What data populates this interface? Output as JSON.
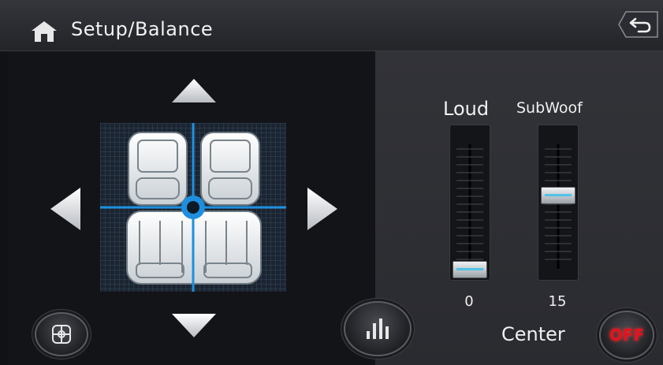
{
  "header": {
    "title": "Setup/Balance",
    "home_icon": "home-icon",
    "back_icon": "back-arrow-icon"
  },
  "balance": {
    "up_icon": "arrow-up-icon",
    "down_icon": "arrow-down-icon",
    "left_icon": "arrow-left-icon",
    "right_icon": "arrow-right-icon",
    "seat_map_icon": "car-seats-icon",
    "reset_icon": "center-reset-icon",
    "position": {
      "x": 0,
      "y": 0
    }
  },
  "eq_button": {
    "icon": "equalizer-icon"
  },
  "sliders": [
    {
      "label": "Loud",
      "value": "0",
      "min": 0,
      "max": 20,
      "level": 0
    },
    {
      "label": "SubWoof",
      "value": "15",
      "min": 0,
      "max": 20,
      "level": 15
    }
  ],
  "center": {
    "label": "Center",
    "toggle_text": "OFF",
    "toggle_state": "off"
  },
  "colors": {
    "accent_blue": "#1e8fe0",
    "off_red": "#e0141e",
    "text": "#f0f0f0"
  }
}
